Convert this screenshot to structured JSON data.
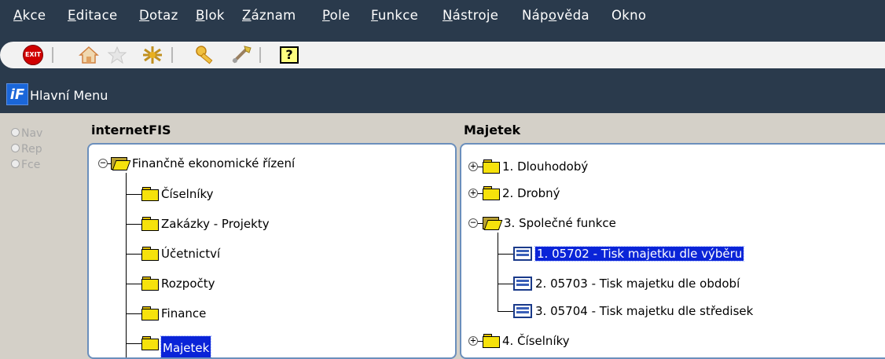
{
  "menu": [
    {
      "pre": "",
      "u": "A",
      "post": "kce"
    },
    {
      "pre": "",
      "u": "E",
      "post": "ditace"
    },
    {
      "pre": "",
      "u": "D",
      "post": "otaz"
    },
    {
      "pre": "",
      "u": "B",
      "post": "lok"
    },
    {
      "pre": "",
      "u": "Z",
      "post": "áznam"
    },
    {
      "pre": "",
      "u": "P",
      "post": "ole"
    },
    {
      "pre": "",
      "u": "F",
      "post": "unkce"
    },
    {
      "pre": "",
      "u": "N",
      "post": "ástroje"
    },
    {
      "pre": "Náp",
      "u": "o",
      "post": "věda"
    },
    {
      "pre": "Okno",
      "u": "",
      "post": ""
    }
  ],
  "toolbar": {
    "exit_label": "EXIT",
    "help_label": "?",
    "icons": [
      "exit-icon",
      "home-icon",
      "star-icon",
      "network-icon",
      "key-icon",
      "tools-icon",
      "help-icon"
    ]
  },
  "window": {
    "title": "Hlavní Menu",
    "app_icon": "iF"
  },
  "radios": [
    {
      "label": "Nav"
    },
    {
      "label": "Rep"
    },
    {
      "label": "Fce"
    }
  ],
  "left_panel": {
    "header": "internetFIS",
    "root": "Finančně ekonomické řízení",
    "items": [
      "Číselníky",
      "Zakázky - Projekty",
      "Účetnictví",
      "Rozpočty",
      "Finance",
      "Majetek"
    ],
    "selected": "Majetek"
  },
  "right_panel": {
    "header": "Majetek",
    "items": [
      {
        "label": "1. Dlouhodobý",
        "type": "folder",
        "expanded": false
      },
      {
        "label": "2. Drobný",
        "type": "folder",
        "expanded": false
      },
      {
        "label": "3. Společné funkce",
        "type": "folder",
        "expanded": true
      },
      {
        "label": "1. 05702 - Tisk majetku dle výběru",
        "type": "form",
        "selected": true
      },
      {
        "label": "2. 05703 - Tisk majetku dle období",
        "type": "form"
      },
      {
        "label": "3. 05704 - Tisk  majetku dle středisek",
        "type": "form"
      },
      {
        "label": "4. Číselníky",
        "type": "folder",
        "expanded": false
      }
    ]
  },
  "colors": {
    "chrome": "#2a3a4c",
    "selection": "#0a24d8",
    "folder": "#f6e20c",
    "panel_border": "#6b8fbc"
  }
}
